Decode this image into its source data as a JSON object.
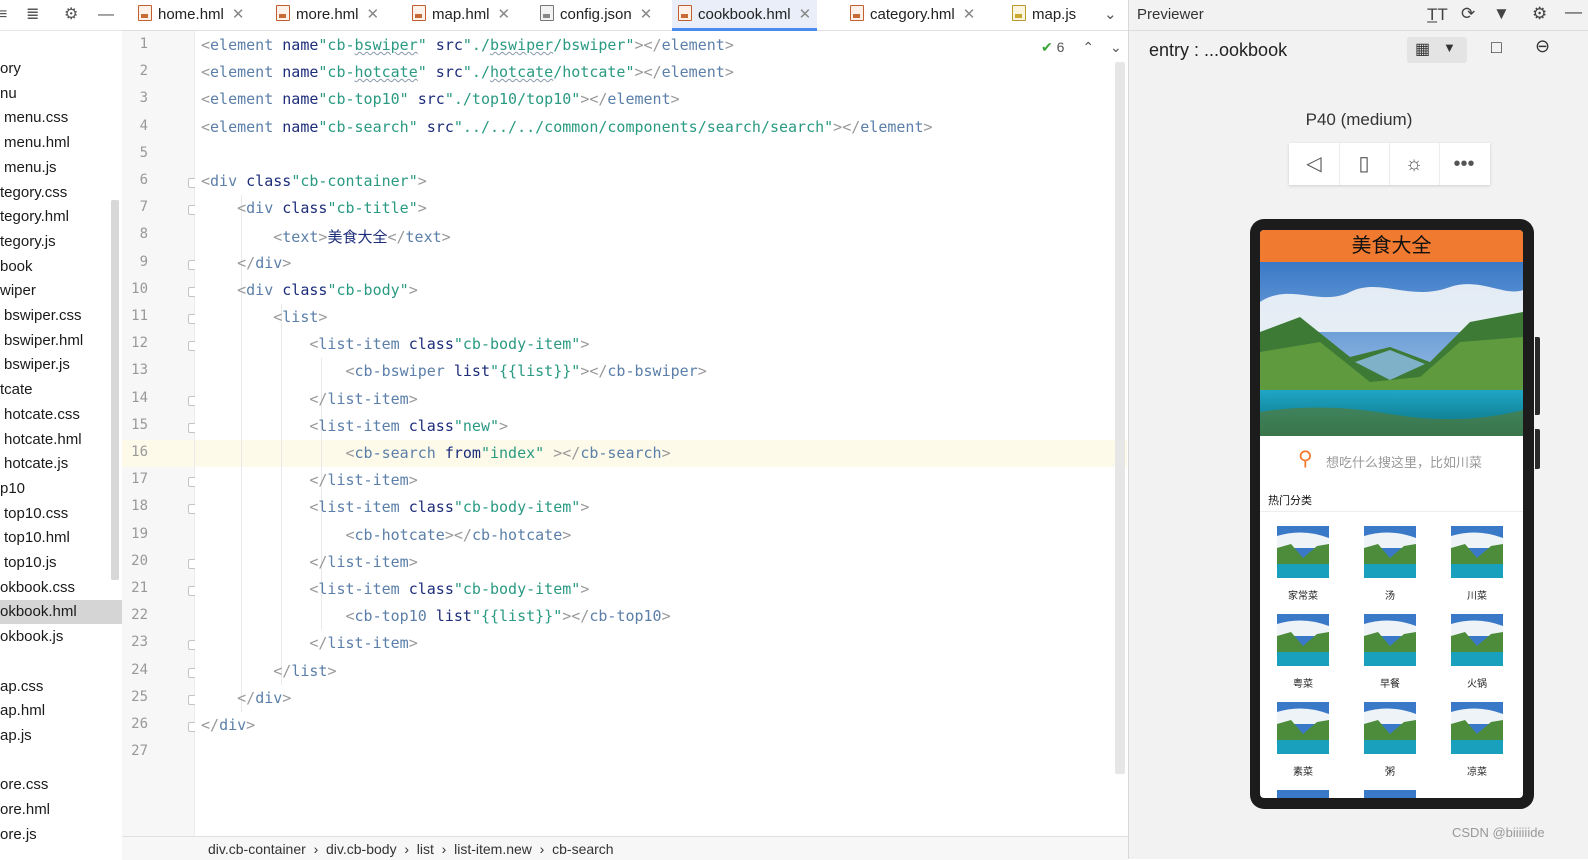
{
  "tree": {
    "items": [
      {
        "label": "ory",
        "indent": 0
      },
      {
        "label": "nu",
        "indent": 0
      },
      {
        "label": "menu.css",
        "indent": 4
      },
      {
        "label": "menu.hml",
        "indent": 4
      },
      {
        "label": "menu.js",
        "indent": 4
      },
      {
        "label": "tegory.css",
        "indent": 0
      },
      {
        "label": "tegory.hml",
        "indent": 0
      },
      {
        "label": "tegory.js",
        "indent": 0
      },
      {
        "label": "book",
        "indent": 0
      },
      {
        "label": "wiper",
        "indent": 0
      },
      {
        "label": "bswiper.css",
        "indent": 4
      },
      {
        "label": "bswiper.hml",
        "indent": 4
      },
      {
        "label": "bswiper.js",
        "indent": 4
      },
      {
        "label": "tcate",
        "indent": 0
      },
      {
        "label": "hotcate.css",
        "indent": 4
      },
      {
        "label": "hotcate.hml",
        "indent": 4
      },
      {
        "label": "hotcate.js",
        "indent": 4
      },
      {
        "label": "p10",
        "indent": 0
      },
      {
        "label": "top10.css",
        "indent": 4
      },
      {
        "label": "top10.hml",
        "indent": 4
      },
      {
        "label": "top10.js",
        "indent": 4
      },
      {
        "label": "okbook.css",
        "indent": 0
      },
      {
        "label": "okbook.hml",
        "indent": 0,
        "selected": true
      },
      {
        "label": "okbook.js",
        "indent": 0
      },
      {
        "label": "",
        "indent": 0
      },
      {
        "label": "ap.css",
        "indent": 0
      },
      {
        "label": "ap.hml",
        "indent": 0
      },
      {
        "label": "ap.js",
        "indent": 0
      },
      {
        "label": "",
        "indent": 0
      },
      {
        "label": "ore.css",
        "indent": 0
      },
      {
        "label": "ore.hml",
        "indent": 0
      },
      {
        "label": "ore.js",
        "indent": 0
      }
    ]
  },
  "tabs": [
    {
      "label": "home.hml",
      "type": "hml"
    },
    {
      "label": "more.hml",
      "type": "hml"
    },
    {
      "label": "map.hml",
      "type": "hml"
    },
    {
      "label": "config.json",
      "type": "json"
    },
    {
      "label": "cookbook.hml",
      "type": "hml",
      "active": true
    },
    {
      "label": "category.hml",
      "type": "hml"
    },
    {
      "label": "map.js",
      "type": "js"
    }
  ],
  "editor": {
    "inspection_count": "6",
    "highlight_line": 16,
    "lines": [
      "<element name=\"cb-bswiper\" src=\"./bswiper/bswiper\"></element>",
      "<element name=\"cb-hotcate\" src=\"./hotcate/hotcate\"></element>",
      "<element name=\"cb-top10\" src=\"./top10/top10\"></element>",
      "<element name=\"cb-search\" src=\"../../../common/components/search/search\"></element>",
      "",
      "<div class=\"cb-container\">",
      "    <div class=\"cb-title\">",
      "        <text>美食大全</text>",
      "    </div>",
      "    <div class=\"cb-body\">",
      "        <list>",
      "            <list-item class=\"cb-body-item\">",
      "                <cb-bswiper list=\"{{list}}\"></cb-bswiper>",
      "            </list-item>",
      "            <list-item class=\"new\">",
      "                <cb-search from=\"index\" ></cb-search>",
      "            </list-item>",
      "            <list-item class=\"cb-body-item\">",
      "                <cb-hotcate></cb-hotcate>",
      "            </list-item>",
      "            <list-item class=\"cb-body-item\">",
      "                <cb-top10 list=\"{{list}}\"></cb-top10>",
      "            </list-item>",
      "        </list>",
      "    </div>",
      "</div>",
      ""
    ],
    "breadcrumb": "div.cb-container  ›  div.cb-body  ›  list  ›  list-item.new  ›  cb-search"
  },
  "previewer": {
    "title": "Previewer",
    "entry": "entry : ...ookbook",
    "device": "P40 (medium)",
    "phone": {
      "header": "美食大全",
      "search_placeholder": "想吃什么搜这里，比如川菜",
      "hot_title": "热门分类",
      "categories": [
        "家常菜",
        "汤",
        "川菜",
        "粤菜",
        "早餐",
        "火锅",
        "素菜",
        "粥",
        "凉菜"
      ]
    }
  },
  "watermark": "CSDN @biiiiiide",
  "colors": {
    "accent": "#4a8bf0",
    "phone_header": "#f07a30",
    "string": "#2a9a82",
    "tag": "#5b7fa8"
  }
}
